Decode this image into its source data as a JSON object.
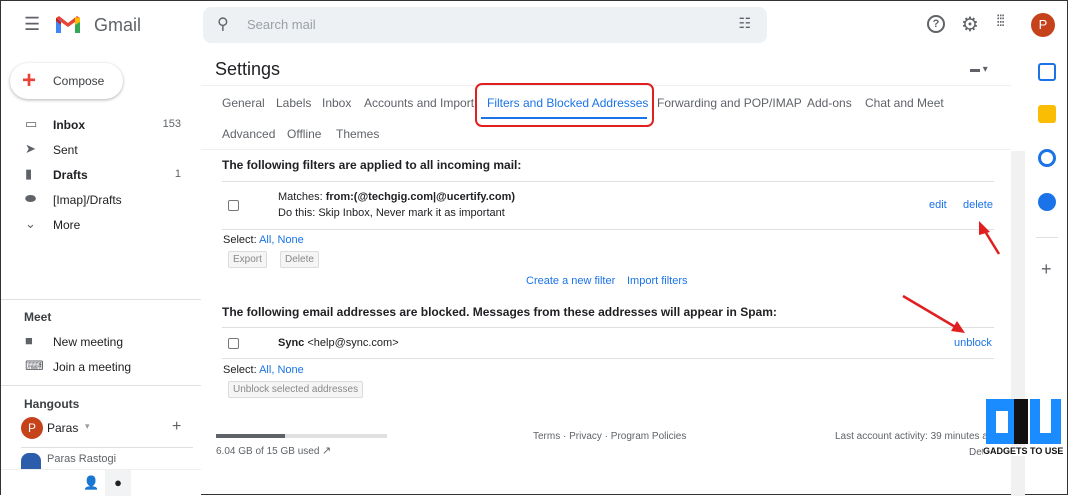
{
  "header": {
    "app_name": "Gmail",
    "search_placeholder": "Search mail",
    "avatar_letter": "P"
  },
  "sidebar": {
    "compose_label": "Compose",
    "items": [
      {
        "label": "Inbox",
        "count": "153",
        "bold": true,
        "icon": "inbox-icon"
      },
      {
        "label": "Sent",
        "count": "",
        "bold": false,
        "icon": "send-icon"
      },
      {
        "label": "Drafts",
        "count": "1",
        "bold": true,
        "icon": "draft-icon"
      },
      {
        "label": "[Imap]/Drafts",
        "count": "",
        "bold": false,
        "icon": "label-icon"
      },
      {
        "label": "More",
        "count": "",
        "bold": false,
        "icon": "chevron-down-icon"
      }
    ],
    "meet": {
      "title": "Meet",
      "new_meeting": "New meeting",
      "join_meeting": "Join a meeting"
    },
    "hangouts": {
      "title": "Hangouts",
      "user": "Paras",
      "user_initial": "P",
      "contact": "Paras Rastogi"
    }
  },
  "settings": {
    "title": "Settings",
    "tabs_row1": [
      "General",
      "Labels",
      "Inbox",
      "Accounts and Import",
      "Filters and Blocked Addresses",
      "Forwarding and POP/IMAP",
      "Add-ons",
      "Chat and Meet"
    ],
    "tabs_row2": [
      "Advanced",
      "Offline",
      "Themes"
    ],
    "active_tab": "Filters and Blocked Addresses",
    "filters": {
      "heading": "The following filters are applied to all incoming mail:",
      "matches_label": "Matches: ",
      "matches_value": "from:(@techgig.com|@ucertify.com)",
      "action": "Do this: Skip Inbox, Never mark it as important",
      "edit": "edit",
      "delete": "delete",
      "select_label": "Select: ",
      "all": "All",
      "none": "None",
      "export": "Export",
      "delete_btn": "Delete",
      "create_filter": "Create a new filter",
      "import_filters": "Import filters"
    },
    "blocked": {
      "heading": "The following email addresses are blocked. Messages from these addresses will appear in Spam:",
      "name": "Sync",
      "email": " <help@sync.com>",
      "unblock": "unblock",
      "select_label": "Select: ",
      "all": "All",
      "none": "None",
      "unblock_selected": "Unblock selected addresses"
    }
  },
  "footer": {
    "storage": "6.04 GB of 15 GB used",
    "storage_fraction": 0.403,
    "links": "Terms · Privacy · Program Policies",
    "activity": "Last account activity: 39 minutes a",
    "details": "Det"
  },
  "watermark": "GADGETS TO USE",
  "colors": {
    "accent": "#1a73e8",
    "highlight": "#e02020",
    "avatar": "#c5421b"
  }
}
